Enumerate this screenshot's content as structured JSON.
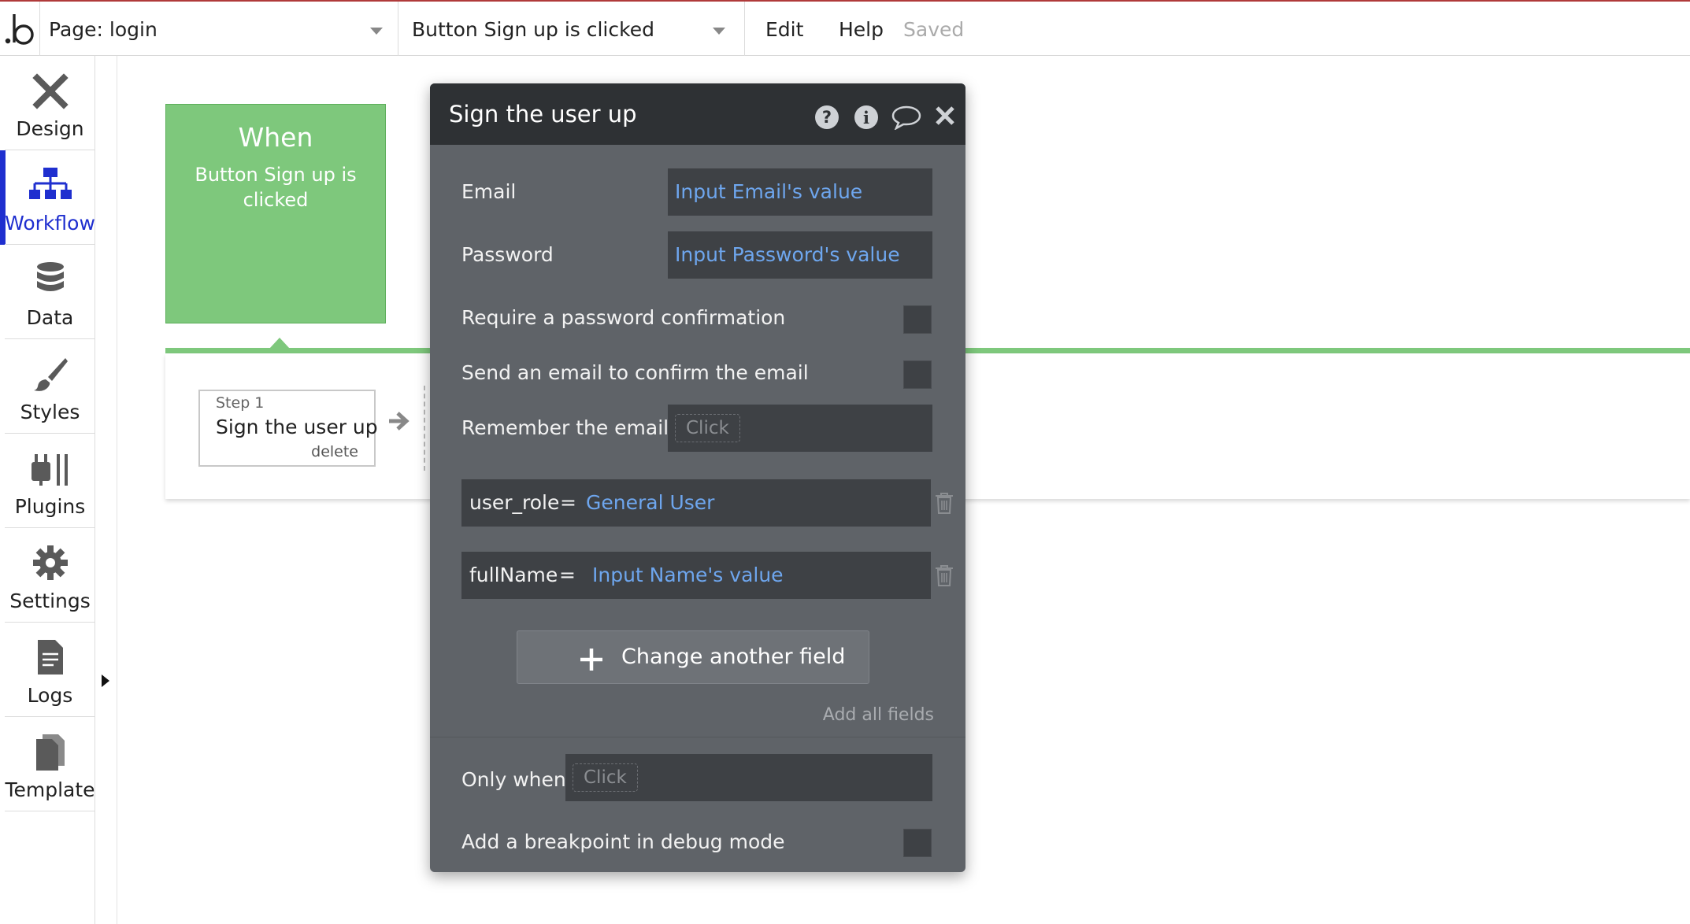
{
  "topbar": {
    "page_dropdown": "Page: login",
    "event_dropdown": "Button Sign up is clicked",
    "menu": {
      "edit": "Edit",
      "help": "Help",
      "saved": "Saved"
    }
  },
  "sidebar": {
    "items": [
      {
        "label": "Design",
        "icon": "design-icon"
      },
      {
        "label": "Workflow",
        "icon": "workflow-icon",
        "active": true
      },
      {
        "label": "Data",
        "icon": "database-icon"
      },
      {
        "label": "Styles",
        "icon": "brush-icon"
      },
      {
        "label": "Plugins",
        "icon": "plug-icon"
      },
      {
        "label": "Settings",
        "icon": "gear-icon"
      },
      {
        "label": "Logs",
        "icon": "document-icon"
      },
      {
        "label": "Template",
        "icon": "template-icon"
      }
    ],
    "active_color": "#1f2fcf"
  },
  "workflow": {
    "event": {
      "title": "When",
      "description": "Button Sign up is clicked"
    },
    "step": {
      "number": "Step 1",
      "title": "Sign the user up",
      "delete": "delete"
    },
    "event_color": "#7ec87c"
  },
  "editor": {
    "title": "Sign the user up",
    "email": {
      "label": "Email",
      "value": "Input Email's value"
    },
    "password": {
      "label": "Password",
      "value": "Input Password's value"
    },
    "require_confirmation": {
      "label": "Require a password confirmation"
    },
    "send_confirm_email": {
      "label": "Send an email to confirm the email"
    },
    "remember_email": {
      "label": "Remember the email",
      "placeholder": "Click"
    },
    "fields": [
      {
        "key": "user_role",
        "eq": "=",
        "value": "General User"
      },
      {
        "key": "fullName",
        "eq": "=",
        "value": "Input Name's value"
      }
    ],
    "change_button": "Change another field",
    "add_all": "Add all fields",
    "only_when": {
      "label": "Only when",
      "placeholder": "Click"
    },
    "breakpoint": {
      "label": "Add a breakpoint in debug mode"
    },
    "link_color": "#6ea6ee"
  }
}
